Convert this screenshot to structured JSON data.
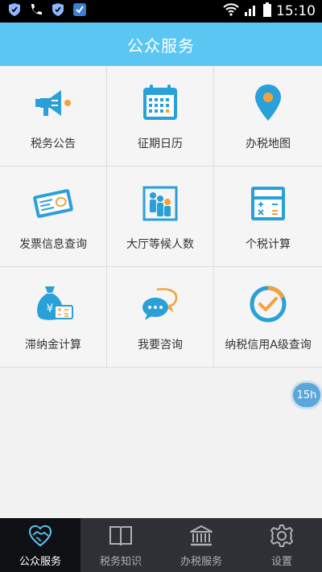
{
  "status_bar": {
    "time": "15:10"
  },
  "header": {
    "title": "公众服务"
  },
  "tiles": [
    {
      "label": "税务公告",
      "icon": "megaphone-icon"
    },
    {
      "label": "征期日历",
      "icon": "calendar-icon"
    },
    {
      "label": "办税地图",
      "icon": "map-pin-icon"
    },
    {
      "label": "发票信息查询",
      "icon": "invoice-icon"
    },
    {
      "label": "大厅等候人数",
      "icon": "queue-people-icon"
    },
    {
      "label": "个税计算",
      "icon": "calculator-icon"
    },
    {
      "label": "滞纳金计算",
      "icon": "money-bag-icon"
    },
    {
      "label": "我要咨询",
      "icon": "chat-bubbles-icon"
    },
    {
      "label": "纳税信用A级查询",
      "icon": "check-circle-icon"
    }
  ],
  "floating_badge": {
    "text": "15h"
  },
  "bottom_nav": [
    {
      "label": "公众服务",
      "icon": "handshake-icon",
      "active": true
    },
    {
      "label": "税务知识",
      "icon": "book-icon",
      "active": false
    },
    {
      "label": "办税服务",
      "icon": "bank-building-icon",
      "active": false
    },
    {
      "label": "设置",
      "icon": "gear-icon",
      "active": false
    }
  ],
  "colors": {
    "accent": "#5bc6f2",
    "icon_blue": "#2aa0d8",
    "icon_orange": "#f5a13a",
    "tab_bg": "#2f2f36",
    "tab_active_bg": "#0f1014"
  }
}
